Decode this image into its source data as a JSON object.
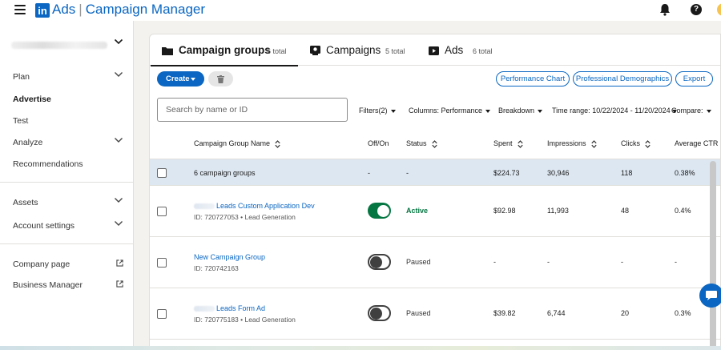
{
  "topbar": {
    "brand": "Ads",
    "separator": "|",
    "product": "Campaign Manager",
    "logo_text": "in",
    "help_label": "?",
    "icons": [
      "menu-icon",
      "bell-icon",
      "help-icon"
    ]
  },
  "sidebar": {
    "items": [
      {
        "label": "Plan",
        "expandable": true
      },
      {
        "label": "Advertise",
        "bold": true
      },
      {
        "label": "Test"
      },
      {
        "label": "Analyze",
        "expandable": true
      },
      {
        "label": "Recommendations"
      },
      {
        "label": "Assets",
        "expandable": true
      },
      {
        "label": "Account settings",
        "expandable": true
      },
      {
        "label": "Company page",
        "external": true
      },
      {
        "label": "Business Manager",
        "external": true
      }
    ]
  },
  "tabs": [
    {
      "label": "Campaign groups",
      "count": "6 total",
      "icon": "folder-icon",
      "active": true
    },
    {
      "label": "Campaigns",
      "count": "5 total",
      "icon": "campaign-icon"
    },
    {
      "label": "Ads",
      "count": "6 total",
      "icon": "ad-icon"
    }
  ],
  "toolbar": {
    "create_label": "Create",
    "performance_chart_label": "Performance Chart",
    "demographics_label": "Professional Demographics",
    "export_label": "Export",
    "search_placeholder": "Search by name or ID",
    "filters_label": "Filters(2)",
    "columns_label": "Columns:",
    "columns_value": "Performance",
    "breakdown_label": "Breakdown",
    "time_range_label": "Time range:",
    "time_range_value": "10/22/2024 - 11/20/2024",
    "compare_label": "Compare:"
  },
  "table": {
    "headers": {
      "name": "Campaign Group Name",
      "onoff": "Off/On",
      "status": "Status",
      "spent": "Spent",
      "impressions": "Impressions",
      "clicks": "Clicks",
      "ctr": "Average CTR"
    },
    "summary": {
      "name": "6 campaign groups",
      "onoff": "-",
      "status": "-",
      "spent": "$224.73",
      "impressions": "30,946",
      "clicks": "118",
      "ctr": "0.38%"
    },
    "rows": [
      {
        "name": "Leads Custom Application Dev",
        "sub": "ID: 720727053 • Lead Generation",
        "on": true,
        "status": "Active",
        "spent": "$92.98",
        "impressions": "11,993",
        "clicks": "48",
        "ctr": "0.4%"
      },
      {
        "name": "New Campaign Group",
        "sub": "ID: 720742163",
        "on": false,
        "status": "Paused",
        "spent": "-",
        "impressions": "-",
        "clicks": "-",
        "ctr": "-"
      },
      {
        "name": "Leads Form Ad",
        "sub": "ID: 720775183 • Lead Generation",
        "on": false,
        "status": "Paused",
        "spent": "$39.82",
        "impressions": "6,744",
        "clicks": "20",
        "ctr": "0.3%"
      }
    ]
  },
  "colors": {
    "brand": "#0a66c2",
    "active_green": "#057642",
    "summary_row": "#dde7f1"
  }
}
